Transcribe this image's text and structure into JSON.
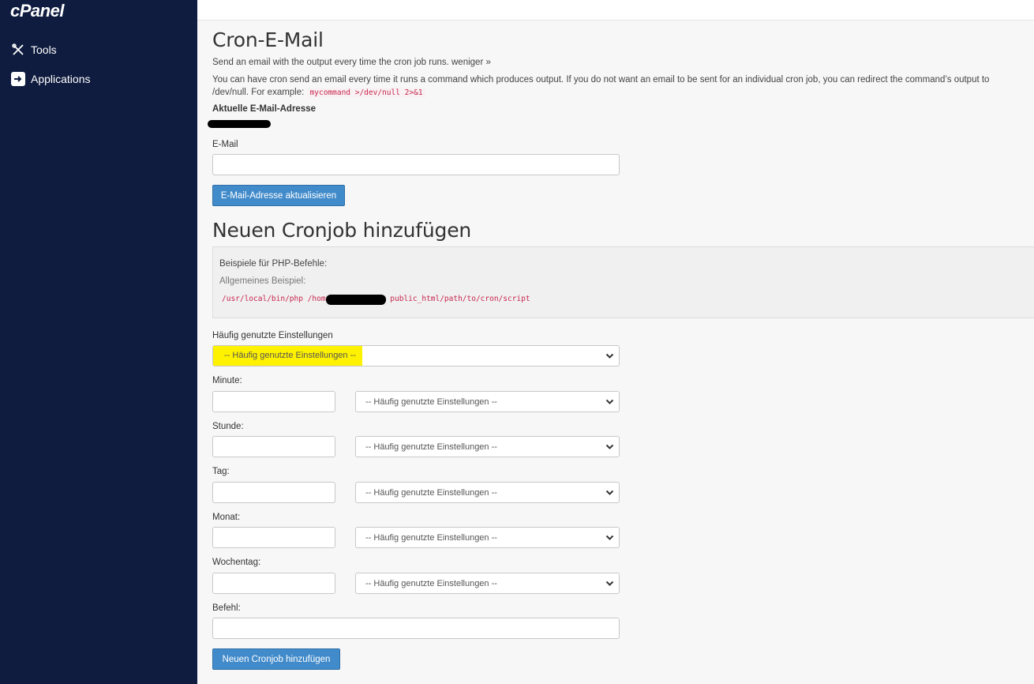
{
  "sidebar": {
    "logo": "cPanel",
    "items": [
      {
        "label": "Tools",
        "icon": "tools-icon"
      },
      {
        "label": "Applications",
        "icon": "applications-icon"
      }
    ]
  },
  "cron_email": {
    "title": "Cron-E-Mail",
    "intro": "Send an email with the output every time the cron job runs. weniger »",
    "desc_line1": "You can have cron send an email every time it runs a command which produces output. If you do not want an email to be sent for an individual cron job, you can redirect the command’s output to",
    "desc_line2": "/dev/null. For example:",
    "example_code": "mycommand >/dev/null 2>&1",
    "current_email_label": "Aktuelle E-Mail-Adresse",
    "email_label": "E-Mail",
    "email_value": "",
    "update_button": "E-Mail-Adresse aktualisieren"
  },
  "new_cron": {
    "title": "Neuen Cronjob hinzufügen",
    "examples_title": "Beispiele für PHP-Befehle:",
    "general_example_label": "Allgemeines Beispiel:",
    "example_path_prefix": "/usr/local/bin/php /home",
    "example_path_suffix": "public_html/path/to/cron/script",
    "common_settings_label": "Häufig genutzte Einstellungen",
    "common_settings_value": "-- Häufig genutzte Einstellungen --",
    "fields": [
      {
        "label": "Minute:",
        "value": "",
        "select": "-- Häufig genutzte Einstellungen --"
      },
      {
        "label": "Stunde:",
        "value": "",
        "select": "-- Häufig genutzte Einstellungen --"
      },
      {
        "label": "Tag:",
        "value": "",
        "select": "-- Häufig genutzte Einstellungen --"
      },
      {
        "label": "Monat:",
        "value": "",
        "select": "-- Häufig genutzte Einstellungen --"
      },
      {
        "label": "Wochentag:",
        "value": "",
        "select": "-- Häufig genutzte Einstellungen --"
      }
    ],
    "command_label": "Befehl:",
    "command_value": "",
    "add_button": "Neuen Cronjob hinzufügen"
  },
  "colors": {
    "sidebar_bg": "#0f1c3f",
    "button_bg": "#428bca",
    "highlight": "#fff200",
    "code_color": "#c7254e"
  }
}
